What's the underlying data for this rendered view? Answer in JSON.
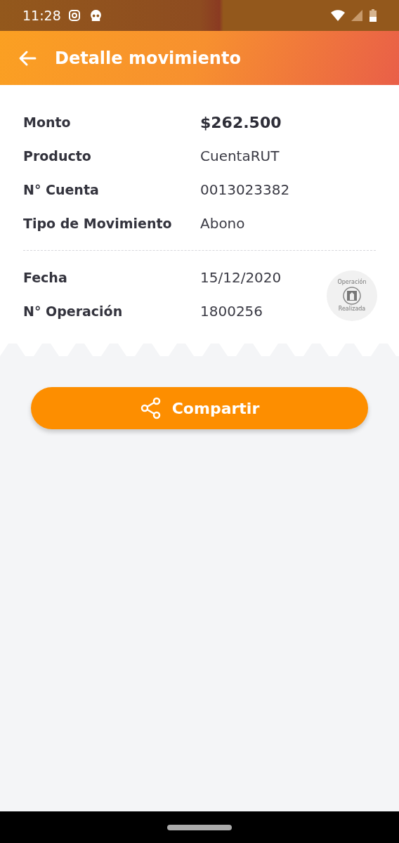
{
  "status_bar": {
    "time": "11:28"
  },
  "header": {
    "title": "Detalle movimiento"
  },
  "sections": [
    {
      "rows": [
        {
          "label": "Monto",
          "value": "$262.500",
          "kind": "amount"
        },
        {
          "label": "Producto",
          "value": "CuentaRUT",
          "kind": "text"
        },
        {
          "label": "N° Cuenta",
          "value": "0013023382",
          "kind": "text"
        },
        {
          "label": "Tipo de Movimiento",
          "value": "Abono",
          "kind": "text"
        }
      ]
    },
    {
      "rows": [
        {
          "label": "Fecha",
          "value": "15/12/2020",
          "kind": "text"
        },
        {
          "label": "N° Operación",
          "value": "1800256",
          "kind": "text"
        }
      ],
      "stamp": {
        "top": "Operación",
        "bottom": "Realizada"
      }
    }
  ],
  "share_button": {
    "label": "Compartir"
  }
}
